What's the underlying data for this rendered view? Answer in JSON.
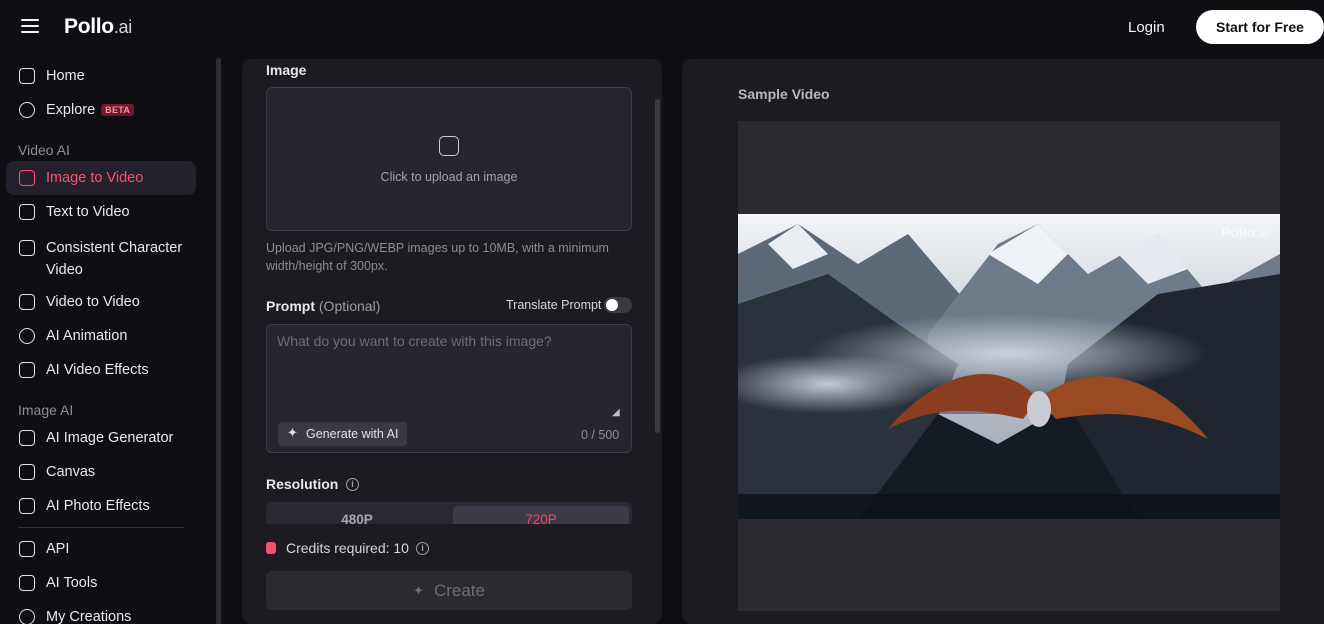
{
  "header": {
    "logo_main": "Pollo",
    "logo_suffix": ".ai",
    "login": "Login",
    "start_free": "Start for Free"
  },
  "sidebar": {
    "home": "Home",
    "explore": "Explore",
    "beta": "BETA",
    "section_video": "Video AI",
    "image_to_video": "Image to Video",
    "text_to_video": "Text to Video",
    "consistent_1": "Consistent Character",
    "consistent_2": "Video",
    "video_to_video": "Video to Video",
    "ai_animation": "AI Animation",
    "ai_video_effects": "AI Video Effects",
    "section_image": "Image AI",
    "ai_image_generator": "AI Image Generator",
    "canvas": "Canvas",
    "ai_photo_effects": "AI Photo Effects",
    "api": "API",
    "ai_tools": "AI Tools",
    "my_creations": "My Creations"
  },
  "form": {
    "image_label": "Image",
    "upload_text": "Click to upload an image",
    "upload_hint": "Upload JPG/PNG/WEBP images up to 10MB, with a minimum width/height of 300px.",
    "prompt_label": "Prompt",
    "prompt_optional": "(Optional)",
    "translate_label": "Translate Prompt",
    "translate_enabled": false,
    "prompt_placeholder": "What do you want to create with this image?",
    "generate_ai": "Generate with AI",
    "char_counter": "0 / 500",
    "resolution_label": "Resolution",
    "res_480": "480P",
    "res_720": "720P",
    "selected_resolution": "720P",
    "credits": "Credits required: 10",
    "create": "Create"
  },
  "sample": {
    "title": "Sample Video",
    "watermark_main": "Pollo",
    "watermark_suffix": ".ai"
  },
  "colors": {
    "accent": "#ff4f6f",
    "bg": "#0f0e13",
    "panel": "#1c1b22"
  }
}
